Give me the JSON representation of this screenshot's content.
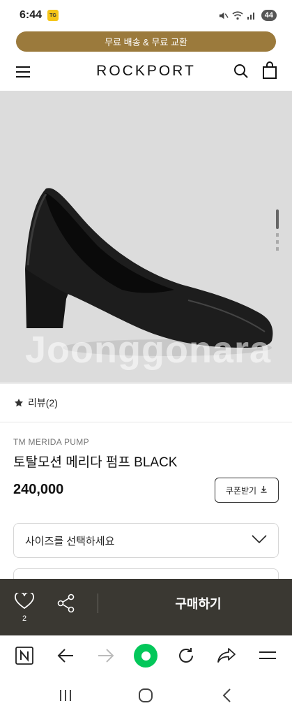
{
  "status": {
    "time": "6:44",
    "battery": "44",
    "app_badge": "TG"
  },
  "promo": {
    "text": "무료 배송 & 무료 교환"
  },
  "header": {
    "logo": "ROCKPORT"
  },
  "product_image": {
    "watermark": "Joonggonara",
    "slide_count": 5,
    "active_slide": 1
  },
  "reviews": {
    "label": "리뷰(2)"
  },
  "product": {
    "brand_line": "TM MERIDA PUMP",
    "name": "토탈모션 메리다 펌프 BLACK",
    "price": "240,000",
    "coupon_label": "쿠폰받기"
  },
  "options": {
    "size_placeholder": "사이즈를 선택하세요"
  },
  "purchase_bar": {
    "like_count": "2",
    "buy_label": "구매하기"
  },
  "colors": {
    "promo": "#9b7a3c",
    "purchase_bar": "#3a3832",
    "naver_green": "#03c75a"
  }
}
